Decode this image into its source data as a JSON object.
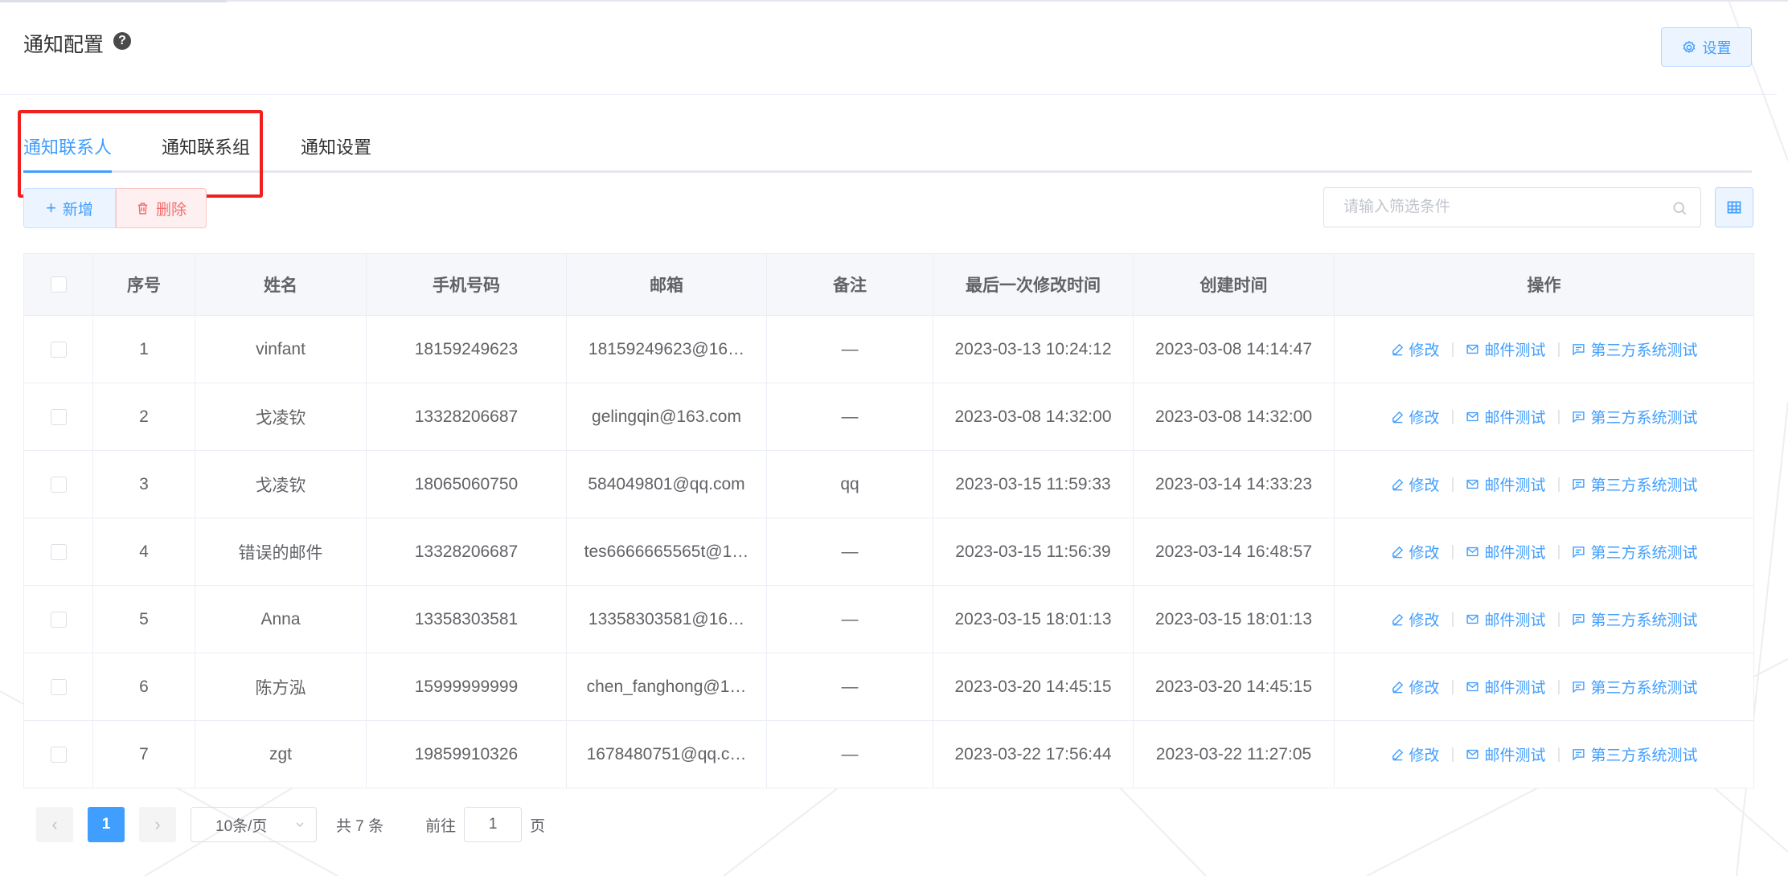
{
  "header": {
    "title": "通知配置",
    "help": "?",
    "settings_label": "设置"
  },
  "tabs": [
    {
      "label": "通知联系人",
      "active": true
    },
    {
      "label": "通知联系组",
      "active": false
    },
    {
      "label": "通知设置",
      "active": false
    }
  ],
  "toolbar": {
    "add_label": "新增",
    "delete_label": "删除",
    "search_placeholder": "请输入筛选条件"
  },
  "table": {
    "columns": [
      "序号",
      "姓名",
      "手机号码",
      "邮箱",
      "备注",
      "最后一次修改时间",
      "创建时间",
      "操作"
    ],
    "rows": [
      {
        "index": "1",
        "name": "vinfant",
        "phone": "18159249623",
        "email": "18159249623@16…",
        "remark": "—",
        "modified": "2023-03-13 10:24:12",
        "created": "2023-03-08 14:14:47"
      },
      {
        "index": "2",
        "name": "戈凌钦",
        "phone": "13328206687",
        "email": "gelingqin@163.com",
        "remark": "—",
        "modified": "2023-03-08 14:32:00",
        "created": "2023-03-08 14:32:00"
      },
      {
        "index": "3",
        "name": "戈凌钦",
        "phone": "18065060750",
        "email": "584049801@qq.com",
        "remark": "qq",
        "modified": "2023-03-15 11:59:33",
        "created": "2023-03-14 14:33:23"
      },
      {
        "index": "4",
        "name": "错误的邮件",
        "phone": "13328206687",
        "email": "tes6666665565t@1…",
        "remark": "—",
        "modified": "2023-03-15 11:56:39",
        "created": "2023-03-14 16:48:57"
      },
      {
        "index": "5",
        "name": "Anna",
        "phone": "13358303581",
        "email": "13358303581@16…",
        "remark": "—",
        "modified": "2023-03-15 18:01:13",
        "created": "2023-03-15 18:01:13"
      },
      {
        "index": "6",
        "name": "陈方泓",
        "phone": "15999999999",
        "email": "chen_fanghong@1…",
        "remark": "—",
        "modified": "2023-03-20 14:45:15",
        "created": "2023-03-20 14:45:15"
      },
      {
        "index": "7",
        "name": "zgt",
        "phone": "19859910326",
        "email": "1678480751@qq.c…",
        "remark": "—",
        "modified": "2023-03-22 17:56:44",
        "created": "2023-03-22 11:27:05"
      }
    ],
    "actions": {
      "edit": "修改",
      "mail_test": "邮件测试",
      "third_party_test": "第三方系统测试"
    }
  },
  "pagination": {
    "current_page": "1",
    "page_size": "10条/页",
    "total": "共 7 条",
    "goto_label": "前往",
    "goto_value": "1",
    "page_unit": "页"
  },
  "colors": {
    "primary": "#409eff",
    "danger": "#f56c6c",
    "highlight": "#f02020"
  }
}
